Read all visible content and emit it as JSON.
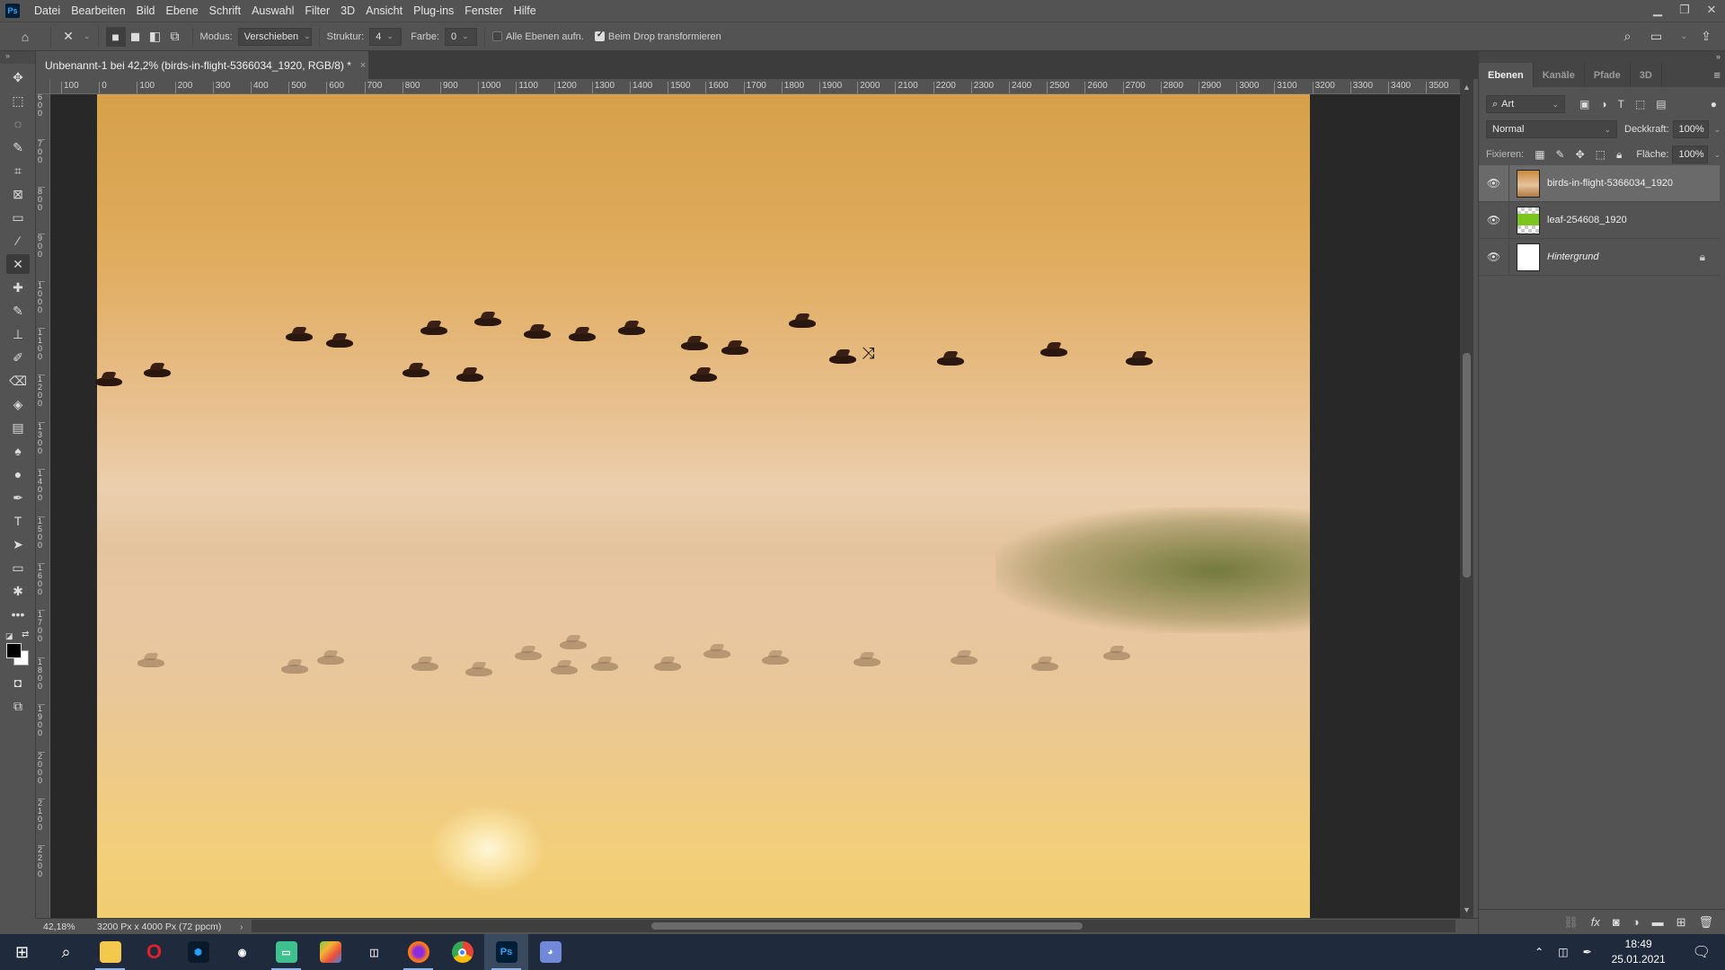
{
  "app": {
    "logo": "Ps"
  },
  "menu": [
    "Datei",
    "Bearbeiten",
    "Bild",
    "Ebene",
    "Schrift",
    "Auswahl",
    "Filter",
    "3D",
    "Ansicht",
    "Plug-ins",
    "Fenster",
    "Hilfe"
  ],
  "window_controls": {
    "minimize": "minimize-icon",
    "restore": "restore-icon",
    "close": "close-icon"
  },
  "options": {
    "modus_label": "Modus:",
    "modus_value": "Verschieben",
    "struktur_label": "Struktur:",
    "struktur_value": "4",
    "farbe_label": "Farbe:",
    "farbe_value": "0",
    "alle_ebenen_label": "Alle Ebenen aufn.",
    "alle_ebenen_checked": false,
    "beim_drop_label": "Beim Drop transformieren",
    "beim_drop_checked": true
  },
  "document": {
    "tab_title": "Unbenannt-1 bei 42,2% (birds-in-flight-5366034_1920, RGB/8) *",
    "close": "×"
  },
  "rulers": {
    "top": [
      "100",
      "0",
      "100",
      "200",
      "300",
      "400",
      "500",
      "600",
      "700",
      "800",
      "900",
      "1000",
      "1100",
      "1200",
      "1300",
      "1400",
      "1500",
      "1600",
      "1700",
      "1800",
      "1900",
      "2000",
      "2100",
      "2200",
      "2300",
      "2400",
      "2500",
      "2600",
      "2700",
      "2800",
      "2900",
      "3000",
      "3100",
      "3200",
      "3300",
      "3400",
      "3500"
    ],
    "left": [
      "600",
      "700",
      "800",
      "900",
      "1000",
      "1100",
      "1200",
      "1300",
      "1400",
      "1500",
      "1600",
      "1700",
      "1800",
      "1900",
      "2000",
      "2100",
      "2200"
    ]
  },
  "tools": [
    "move",
    "marquee",
    "lasso",
    "quick-select",
    "crop",
    "frame",
    "ruler",
    "eyedropper",
    "content-aware-move",
    "healing",
    "brush",
    "stamp",
    "history-brush",
    "eraser",
    "paint-bucket",
    "gradient",
    "blur",
    "dodge",
    "pen",
    "type",
    "path-select",
    "rectangle",
    "custom-shape",
    "more",
    "default-colors",
    "swap-colors",
    "color-swatches",
    "quick-mask",
    "screen-mode"
  ],
  "colors": {
    "foreground": "#000000",
    "background": "#ffffff",
    "accent": "#31a8ff"
  },
  "status": {
    "zoom": "42,18%",
    "doc_info": "3200 Px x 4000 Px (72 ppcm)",
    "arrow": "›",
    "back": "‹"
  },
  "panel": {
    "tabs": [
      "Ebenen",
      "Kanäle",
      "Pfade",
      "3D"
    ],
    "active_tab": "Ebenen",
    "filter_label": "Art",
    "blend_mode": "Normal",
    "opacity_label": "Deckkraft:",
    "opacity_value": "100%",
    "lock_label": "Fixieren:",
    "fill_label": "Fläche:",
    "fill_value": "100%",
    "layers": [
      {
        "name": "birds-in-flight-5366034_1920",
        "visible": true,
        "selected": true,
        "italic": false,
        "locked": false
      },
      {
        "name": "leaf-254608_1920",
        "visible": true,
        "selected": false,
        "italic": false,
        "locked": false
      },
      {
        "name": "Hintergrund",
        "visible": true,
        "selected": false,
        "italic": true,
        "locked": true
      }
    ]
  },
  "taskbar": {
    "apps": [
      "windows-start",
      "search",
      "file-explorer",
      "opera",
      "battle-net",
      "obs-like",
      "chat-app",
      "bluestacks",
      "streamlabs",
      "firefox",
      "chrome",
      "photoshop",
      "discord"
    ],
    "active_app": "photoshop",
    "time": "18:49",
    "date": "25.01.2021"
  }
}
